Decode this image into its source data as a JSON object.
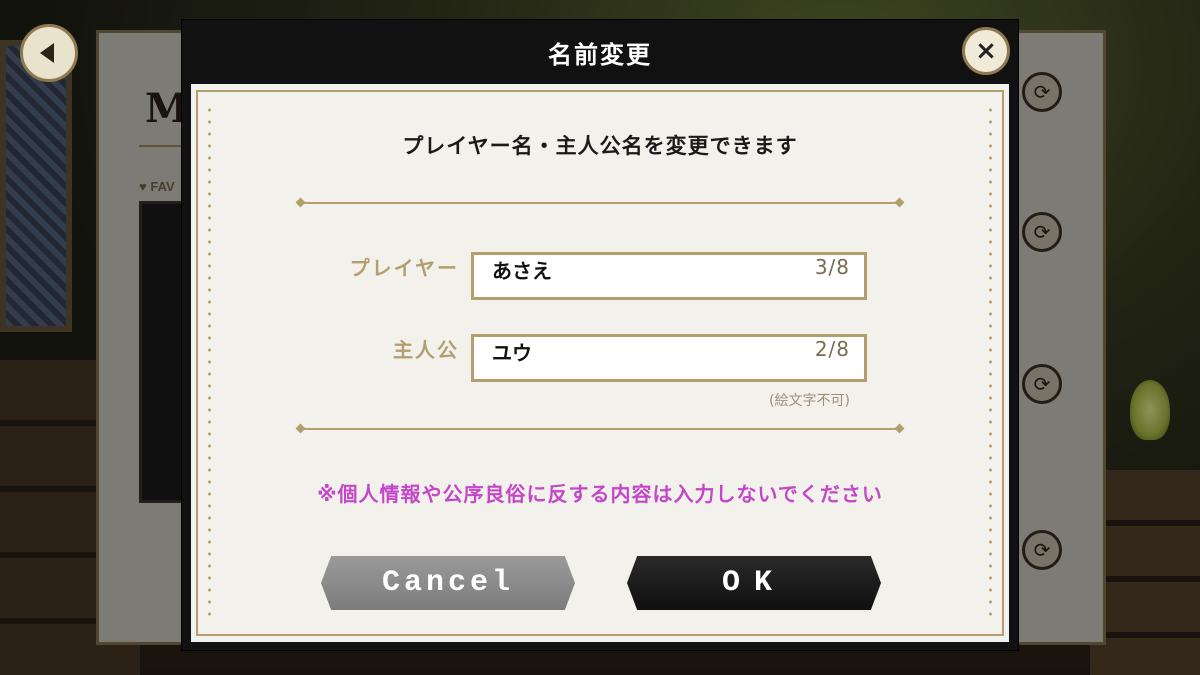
{
  "background": {
    "panel_letter": "M",
    "favorites_label": "FAV"
  },
  "dialog": {
    "title": "名前変更",
    "close_glyph": "×",
    "subtitle": "プレイヤー名・主人公名を変更できます",
    "fields": [
      {
        "label": "プレイヤー",
        "value": "あさえ",
        "count": "3/8"
      },
      {
        "label": "主人公",
        "value": "ユウ",
        "count": "2/8"
      }
    ],
    "emoji_note": "(絵文字不可)",
    "warning": "※個人情報や公序良俗に反する内容は入力しないでください",
    "cancel_label": "Cancel",
    "ok_label": "OK"
  },
  "icons": {
    "back": "chevron-left-icon",
    "close": "close-icon",
    "refresh": "refresh-icon"
  },
  "colors": {
    "gold": "#b39f6e",
    "warning": "#c446c9",
    "dialog_bg": "#111111",
    "paper": "#f3f1ec"
  }
}
